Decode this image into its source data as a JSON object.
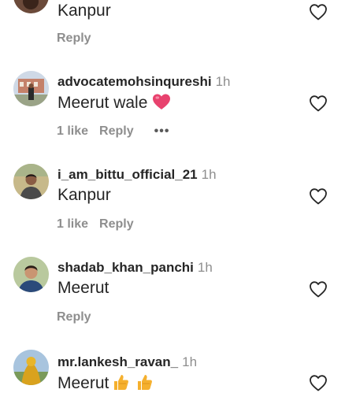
{
  "comments": [
    {
      "text": "Kanpur",
      "reply_label": "Reply"
    },
    {
      "username": "advocatemohsinqureshi",
      "time": "1h",
      "text": "Meerut wale",
      "likes": "1 like",
      "reply_label": "Reply",
      "more_label": "•••"
    },
    {
      "username": "i_am_bittu_official_21",
      "time": "1h",
      "text": "Kanpur",
      "likes": "1 like",
      "reply_label": "Reply"
    },
    {
      "username": "shadab_khan_panchi",
      "time": "1h",
      "text": "Meerut",
      "reply_label": "Reply"
    },
    {
      "username": "mr.lankesh_ravan_",
      "time": "1h",
      "text": "Meerut"
    }
  ],
  "icons": {
    "like": "heart-outline-icon",
    "emoji_heart": "pink-heart-emoji",
    "emoji_thumb": "thumbs-up-emoji"
  },
  "colors": {
    "text": "#262626",
    "secondary": "#8e8e8e",
    "emoji_heart": "#e8426e",
    "emoji_thumb": "#f5b02e"
  }
}
